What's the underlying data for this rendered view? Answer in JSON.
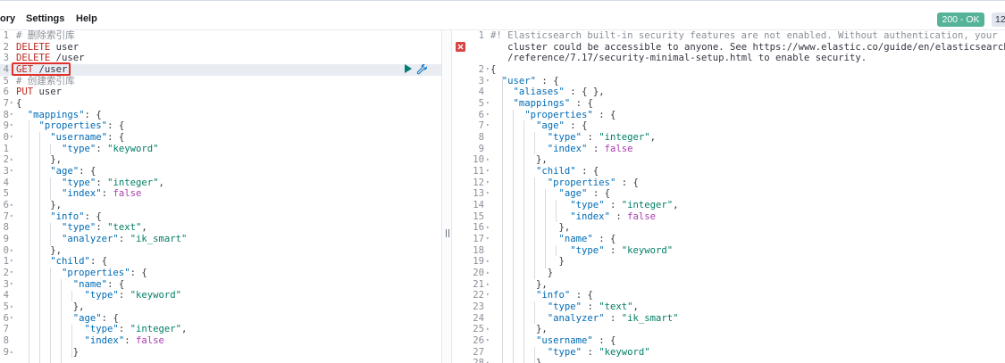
{
  "menu": {
    "history_label": "ory",
    "settings_label": "Settings",
    "help_label": "Help"
  },
  "status": {
    "code_label": "200 - OK",
    "time_label": "12"
  },
  "colors": {
    "comment": "#8a8f98",
    "method": "#bd271e",
    "url": "#343741",
    "key": "#006bb4",
    "string": "#007e66",
    "keyword": "#aa3dad",
    "punct": "#343741",
    "status_ok": "#54b399"
  },
  "icons": {
    "run": "play-triangle-icon",
    "wrench": "wrench-icon",
    "error": "error-x-icon",
    "divider": "drag-handle-icon"
  },
  "request_editor": {
    "lines": [
      {
        "num": "1",
        "fold": "",
        "text": "# 删除索引库"
      },
      {
        "num": "2",
        "fold": "",
        "text": "DELETE user"
      },
      {
        "num": "3",
        "fold": "",
        "text": "DELETE /user"
      },
      {
        "num": "4",
        "fold": "",
        "text": "GET /user",
        "active": true
      },
      {
        "num": "5",
        "fold": "",
        "text": "# 创建索引库"
      },
      {
        "num": "6",
        "fold": "",
        "text": "PUT user"
      },
      {
        "num": "7",
        "fold": "▾",
        "text": "{"
      },
      {
        "num": "8",
        "fold": "▾",
        "text": "  \"mappings\": {"
      },
      {
        "num": "9",
        "fold": "▾",
        "text": "    \"properties\": {"
      },
      {
        "num": "0",
        "fold": "▾",
        "text": "      \"username\": {"
      },
      {
        "num": "1",
        "fold": "",
        "text": "        \"type\": \"keyword\""
      },
      {
        "num": "2",
        "fold": "▴",
        "text": "      },"
      },
      {
        "num": "3",
        "fold": "▾",
        "text": "      \"age\": {"
      },
      {
        "num": "4",
        "fold": "",
        "text": "        \"type\": \"integer\","
      },
      {
        "num": "5",
        "fold": "",
        "text": "        \"index\": false"
      },
      {
        "num": "6",
        "fold": "▴",
        "text": "      },"
      },
      {
        "num": "7",
        "fold": "▾",
        "text": "      \"info\": {"
      },
      {
        "num": "8",
        "fold": "",
        "text": "        \"type\": \"text\","
      },
      {
        "num": "9",
        "fold": "",
        "text": "        \"analyzer\": \"ik_smart\""
      },
      {
        "num": "0",
        "fold": "▴",
        "text": "      },"
      },
      {
        "num": "1",
        "fold": "▾",
        "text": "      \"child\": {"
      },
      {
        "num": "2",
        "fold": "▾",
        "text": "        \"properties\": {"
      },
      {
        "num": "3",
        "fold": "▾",
        "text": "          \"name\": {"
      },
      {
        "num": "4",
        "fold": "",
        "text": "            \"type\": \"keyword\""
      },
      {
        "num": "5",
        "fold": "▴",
        "text": "          },"
      },
      {
        "num": "6",
        "fold": "▾",
        "text": "          \"age\": {"
      },
      {
        "num": "7",
        "fold": "",
        "text": "            \"type\": \"integer\","
      },
      {
        "num": "8",
        "fold": "",
        "text": "            \"index\": false"
      },
      {
        "num": "9",
        "fold": "▴",
        "text": "          }"
      }
    ]
  },
  "response_viewer": {
    "lines": [
      {
        "num": "1",
        "fold": "",
        "text": "#! Elasticsearch built-in security features are not enabled. Without authentication, your",
        "error": true
      },
      {
        "num": "",
        "fold": "",
        "text": "   cluster could be accessible to anyone. See https://www.elastic.co/guide/en/elasticsearch"
      },
      {
        "num": "",
        "fold": "",
        "text": "   /reference/7.17/security-minimal-setup.html to enable security."
      },
      {
        "num": "2",
        "fold": "▾",
        "text": "{"
      },
      {
        "num": "3",
        "fold": "▾",
        "text": "  \"user\" : {"
      },
      {
        "num": "4",
        "fold": "",
        "text": "    \"aliases\" : { },"
      },
      {
        "num": "5",
        "fold": "▾",
        "text": "    \"mappings\" : {"
      },
      {
        "num": "6",
        "fold": "▾",
        "text": "      \"properties\" : {"
      },
      {
        "num": "7",
        "fold": "▾",
        "text": "        \"age\" : {"
      },
      {
        "num": "8",
        "fold": "",
        "text": "          \"type\" : \"integer\","
      },
      {
        "num": "9",
        "fold": "",
        "text": "          \"index\" : false"
      },
      {
        "num": "10",
        "fold": "▴",
        "text": "        },"
      },
      {
        "num": "11",
        "fold": "▾",
        "text": "        \"child\" : {"
      },
      {
        "num": "12",
        "fold": "▾",
        "text": "          \"properties\" : {"
      },
      {
        "num": "13",
        "fold": "▾",
        "text": "            \"age\" : {"
      },
      {
        "num": "14",
        "fold": "",
        "text": "              \"type\" : \"integer\","
      },
      {
        "num": "15",
        "fold": "",
        "text": "              \"index\" : false"
      },
      {
        "num": "16",
        "fold": "▴",
        "text": "            },"
      },
      {
        "num": "17",
        "fold": "▾",
        "text": "            \"name\" : {"
      },
      {
        "num": "18",
        "fold": "",
        "text": "              \"type\" : \"keyword\""
      },
      {
        "num": "19",
        "fold": "▴",
        "text": "            }"
      },
      {
        "num": "20",
        "fold": "▴",
        "text": "          }"
      },
      {
        "num": "21",
        "fold": "▴",
        "text": "        },"
      },
      {
        "num": "22",
        "fold": "▾",
        "text": "        \"info\" : {"
      },
      {
        "num": "23",
        "fold": "",
        "text": "          \"type\" : \"text\","
      },
      {
        "num": "24",
        "fold": "",
        "text": "          \"analyzer\" : \"ik_smart\""
      },
      {
        "num": "25",
        "fold": "▴",
        "text": "        },"
      },
      {
        "num": "26",
        "fold": "▾",
        "text": "        \"username\" : {"
      },
      {
        "num": "27",
        "fold": "",
        "text": "          \"type\" : \"keyword\""
      },
      {
        "num": "28",
        "fold": "▴",
        "text": "        }"
      }
    ]
  }
}
